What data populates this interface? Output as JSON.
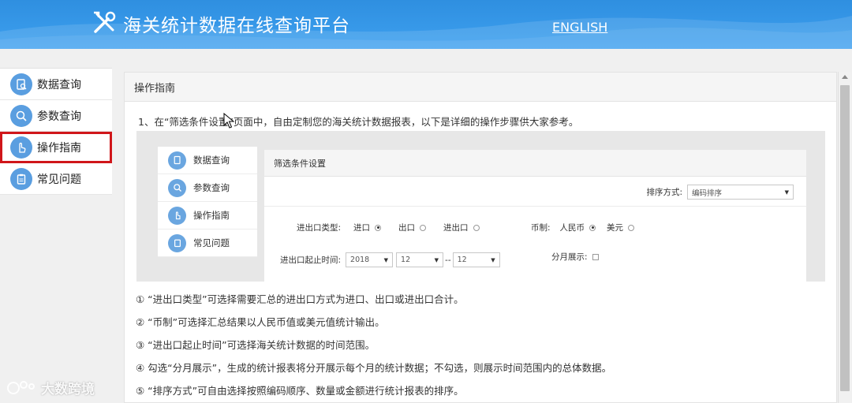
{
  "header": {
    "title": "海关统计数据在线查询平台",
    "lang_link": "ENGLISH"
  },
  "sidebar": {
    "items": [
      {
        "label": "数据查询",
        "icon": "document-search-icon"
      },
      {
        "label": "参数查询",
        "icon": "magnifier-icon"
      },
      {
        "label": "操作指南",
        "icon": "hand-pointer-icon",
        "highlighted": true
      },
      {
        "label": "常见问题",
        "icon": "clipboard-icon"
      }
    ]
  },
  "main": {
    "section_title": "操作指南",
    "intro": "1、在“筛选条件设置”页面中，自由定制您的海关统计数据报表，以下是详细的操作步骤供大家参考。"
  },
  "embedded": {
    "side_items": [
      "数据查询",
      "参数查询",
      "操作指南",
      "常见问题"
    ],
    "panel_title": "筛选条件设置",
    "sort_label": "排序方式:",
    "sort_value": "编码排序",
    "trade_type_label": "进出口类型:",
    "trade_options": [
      "进口",
      "出口",
      "进出口"
    ],
    "currency_label": "币制:",
    "currency_options": [
      "人民币",
      "美元"
    ],
    "time_label": "进出口起止时间:",
    "year": "2018",
    "month_start": "12",
    "range_sep": "--",
    "month_end": "12",
    "monthly_label": "分月展示:"
  },
  "notes": [
    "①  “进出口类型”可选择需要汇总的进出口方式为进口、出口或进出口合计。",
    "②  “币制”可选择汇总结果以人民币值或美元值统计输出。",
    "③  “进出口起止时间”可选择海关统计数据的时间范围。",
    "④ 勾选“分月展示”，生成的统计报表将分开展示每个月的统计数据；不勾选，则展示时间范围内的总体数据。",
    "⑤  “排序方式”可自由选择按照编码顺序、数量或金额进行统计报表的排序。"
  ],
  "watermark": "大数跨境",
  "colors": {
    "header_blue": "#3a9aea",
    "icon_blue": "#5a9ee0",
    "highlight_red": "#d0161a"
  }
}
